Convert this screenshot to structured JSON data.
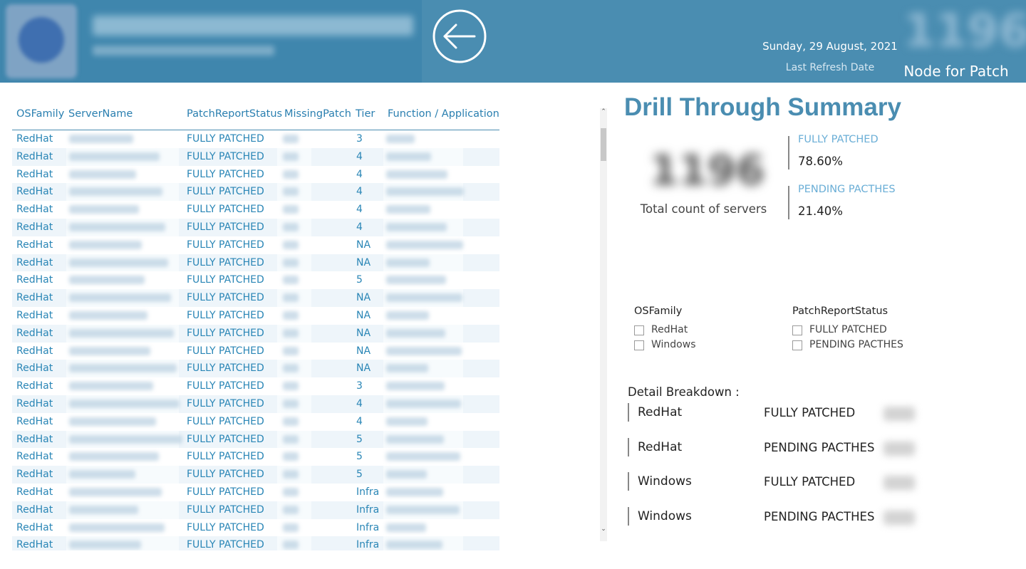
{
  "header": {
    "back_icon": "arrow-left-circle-icon",
    "date": "Sunday, 29 August, 2021",
    "refresh_label": "Last Refresh Date",
    "node_label": "Node for Patch",
    "colors": {
      "header_bg": "#4a8db1",
      "accent": "#2a86b6"
    }
  },
  "table": {
    "columns": [
      "OSFamily",
      "ServerName",
      "PatchReportStatus",
      "MissingPatch",
      "Tier",
      "Function / Application"
    ],
    "rows": [
      {
        "os": "RedHat",
        "status": "FULLY PATCHED",
        "tier": "3"
      },
      {
        "os": "RedHat",
        "status": "FULLY PATCHED",
        "tier": "4"
      },
      {
        "os": "RedHat",
        "status": "FULLY PATCHED",
        "tier": "4"
      },
      {
        "os": "RedHat",
        "status": "FULLY PATCHED",
        "tier": "4"
      },
      {
        "os": "RedHat",
        "status": "FULLY PATCHED",
        "tier": "4"
      },
      {
        "os": "RedHat",
        "status": "FULLY PATCHED",
        "tier": "4"
      },
      {
        "os": "RedHat",
        "status": "FULLY PATCHED",
        "tier": "NA"
      },
      {
        "os": "RedHat",
        "status": "FULLY PATCHED",
        "tier": "NA"
      },
      {
        "os": "RedHat",
        "status": "FULLY PATCHED",
        "tier": "5"
      },
      {
        "os": "RedHat",
        "status": "FULLY PATCHED",
        "tier": "NA"
      },
      {
        "os": "RedHat",
        "status": "FULLY PATCHED",
        "tier": "NA"
      },
      {
        "os": "RedHat",
        "status": "FULLY PATCHED",
        "tier": "NA"
      },
      {
        "os": "RedHat",
        "status": "FULLY PATCHED",
        "tier": "NA"
      },
      {
        "os": "RedHat",
        "status": "FULLY PATCHED",
        "tier": "NA"
      },
      {
        "os": "RedHat",
        "status": "FULLY PATCHED",
        "tier": "3"
      },
      {
        "os": "RedHat",
        "status": "FULLY PATCHED",
        "tier": "4"
      },
      {
        "os": "RedHat",
        "status": "FULLY PATCHED",
        "tier": "4"
      },
      {
        "os": "RedHat",
        "status": "FULLY PATCHED",
        "tier": "5"
      },
      {
        "os": "RedHat",
        "status": "FULLY PATCHED",
        "tier": "5"
      },
      {
        "os": "RedHat",
        "status": "FULLY PATCHED",
        "tier": "5"
      },
      {
        "os": "RedHat",
        "status": "FULLY PATCHED",
        "tier": "Infra"
      },
      {
        "os": "RedHat",
        "status": "FULLY PATCHED",
        "tier": "Infra"
      },
      {
        "os": "RedHat",
        "status": "FULLY PATCHED",
        "tier": "Infra"
      },
      {
        "os": "RedHat",
        "status": "FULLY PATCHED",
        "tier": "Infra"
      }
    ]
  },
  "summary": {
    "title": "Drill Through Summary",
    "total_label": "Total count of servers",
    "kpis": [
      {
        "label": "FULLY PATCHED",
        "value": "78.60%"
      },
      {
        "label": "PENDING PACTHES",
        "value": "21.40%"
      }
    ]
  },
  "slicers": {
    "os": {
      "title": "OSFamily",
      "options": [
        "RedHat",
        "Windows"
      ]
    },
    "status": {
      "title": "PatchReportStatus",
      "options": [
        "FULLY PATCHED",
        "PENDING PACTHES"
      ]
    }
  },
  "detail": {
    "title": "Detail Breakdown :",
    "rows": [
      {
        "os": "RedHat",
        "status": "FULLY PATCHED"
      },
      {
        "os": "RedHat",
        "status": "PENDING PACTHES"
      },
      {
        "os": "Windows",
        "status": "FULLY PATCHED"
      },
      {
        "os": "Windows",
        "status": "PENDING PACTHES"
      }
    ]
  }
}
